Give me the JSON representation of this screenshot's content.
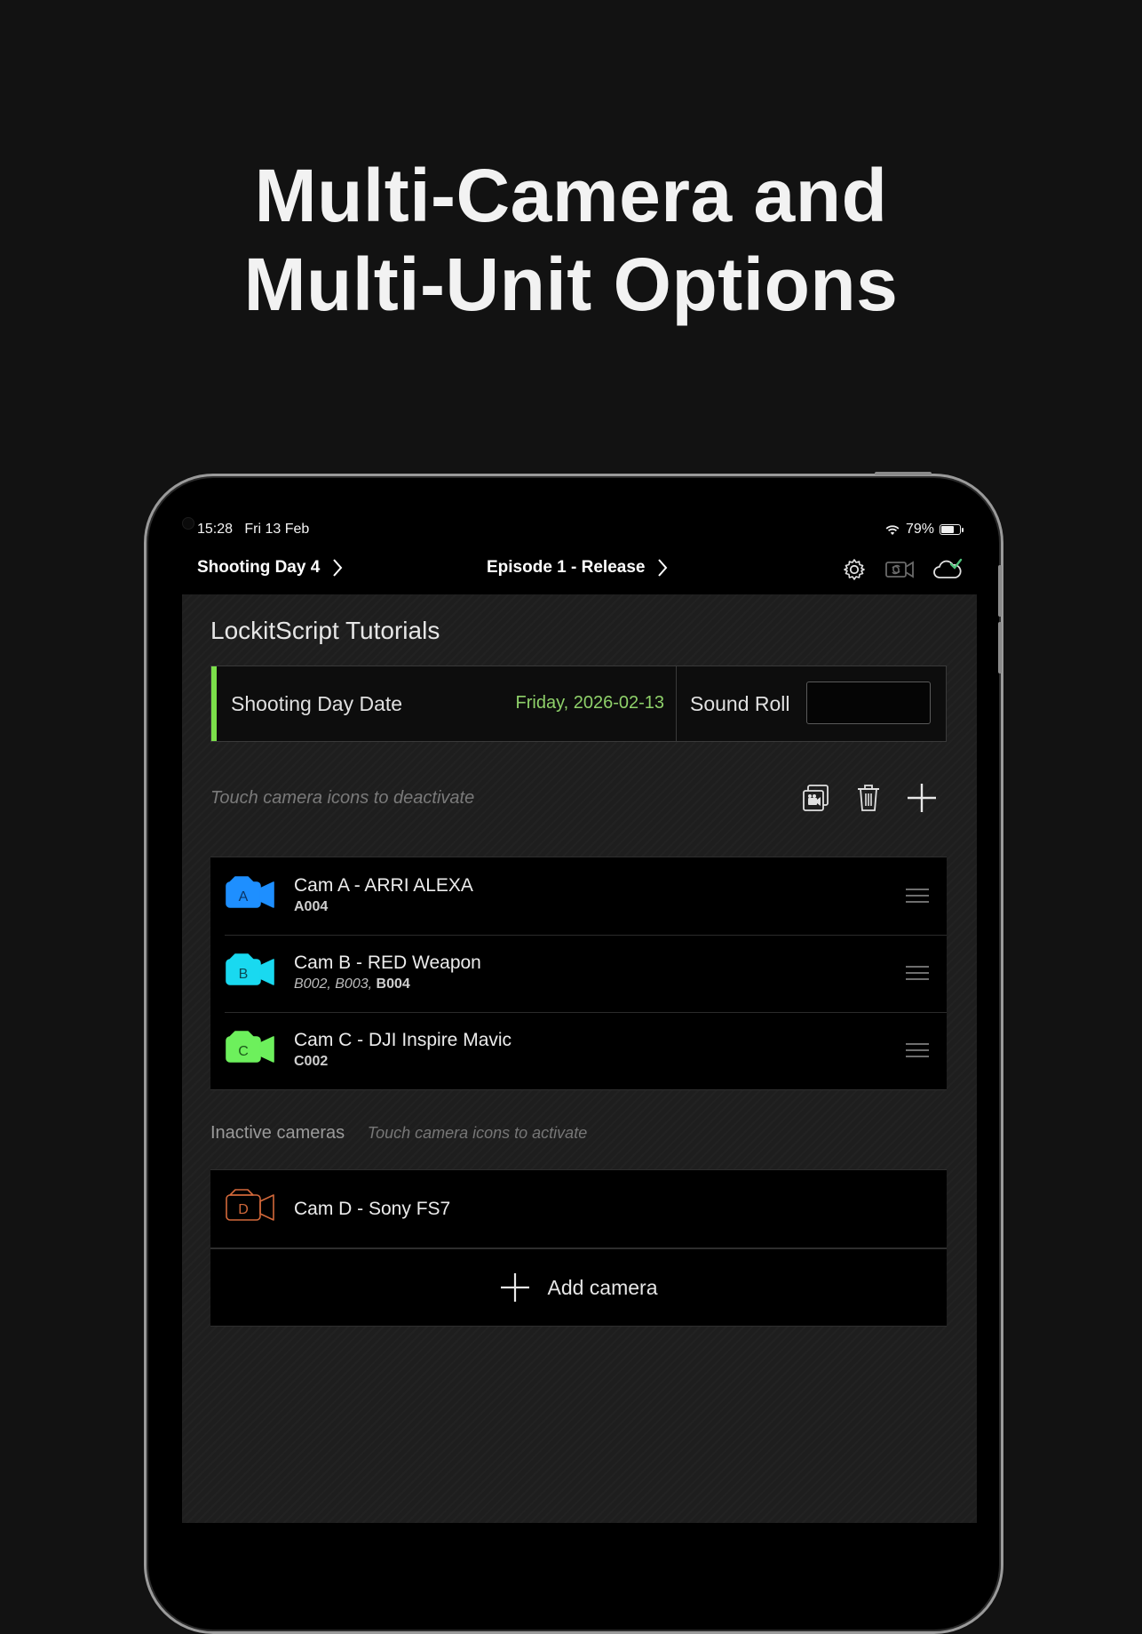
{
  "headline": {
    "line1": "Multi-Camera and",
    "line2": "Multi-Unit Options"
  },
  "status_bar": {
    "time": "15:28",
    "date": "Fri 13 Feb",
    "battery": "79%",
    "battery_level": 0.79
  },
  "nav": {
    "shooting_day": "Shooting Day 4",
    "episode": "Episode 1 - Release",
    "icons": [
      "gear-icon",
      "camera-sync-icon",
      "cloud-check-icon"
    ]
  },
  "project_title": "LockitScript Tutorials",
  "shooting_day_date": {
    "label": "Shooting Day Date",
    "value": "Friday, 2026-02-13",
    "accent": "#7be04a"
  },
  "sound_roll": {
    "label": "Sound Roll",
    "value": ""
  },
  "active_hint": "Touch camera icons to deactivate",
  "toolbar_icons": [
    "duplicate-icon",
    "trash-icon",
    "plus-icon"
  ],
  "active_cameras": [
    {
      "letter": "A",
      "name": "Cam A - ARRI ALEXA",
      "rolls_plain": "",
      "rolls_bold": "A004",
      "color": "#1e8fff"
    },
    {
      "letter": "B",
      "name": "Cam B - RED Weapon",
      "rolls_plain": "B002, B003, ",
      "rolls_bold": "B004",
      "color": "#19d9f0"
    },
    {
      "letter": "C",
      "name": "Cam C - DJI Inspire Mavic",
      "rolls_plain": "",
      "rolls_bold": "C002",
      "color": "#6df05c"
    }
  ],
  "inactive": {
    "title": "Inactive cameras",
    "hint": "Touch camera icons to activate",
    "cameras": [
      {
        "letter": "D",
        "name": "Cam D - Sony FS7",
        "color": "#d2683a"
      }
    ]
  },
  "add_camera_label": "Add camera"
}
